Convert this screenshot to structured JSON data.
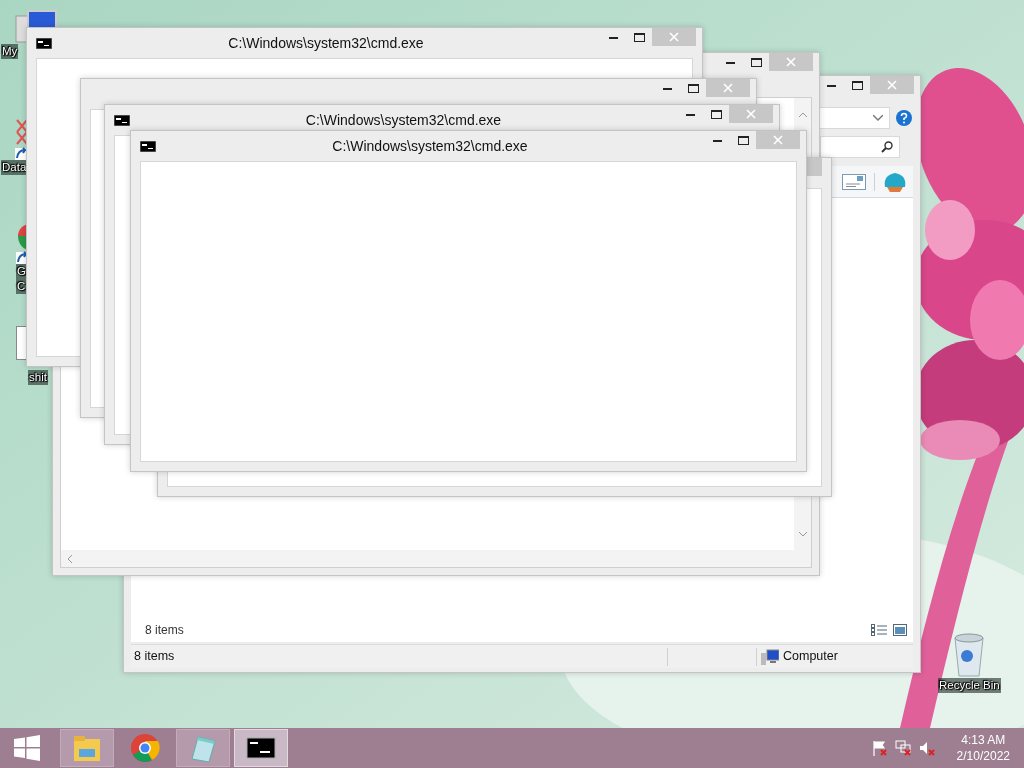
{
  "desktop_icons": [
    {
      "kind": "computer",
      "lines": [
        "My"
      ]
    },
    {
      "kind": "broken-shortcut",
      "lines": [
        "Data"
      ]
    },
    {
      "kind": "chrome-shortcut",
      "lines": [
        "G",
        "C"
      ]
    },
    {
      "kind": "document",
      "lines": [
        "shit"
      ]
    },
    {
      "kind": "recycle",
      "lines": [
        "Recycle Bin"
      ]
    }
  ],
  "windows": [
    {
      "kind": "explorer",
      "item_count": "8 items",
      "status_bar": {
        "left": "8 items",
        "right": "Computer"
      }
    },
    {
      "kind": "scrolled"
    },
    {
      "kind": "console",
      "title": "C:\\Windows\\system32\\cmd.exe"
    },
    {
      "kind": "blank"
    },
    {
      "kind": "console",
      "title": "C:\\Windows\\system32\\cmd.exe"
    },
    {
      "kind": "blank"
    },
    {
      "kind": "console",
      "title": "C:\\Windows\\system32\\cmd.exe"
    }
  ],
  "taskbar": {
    "apps": [
      {
        "kind": "explorer",
        "running": true,
        "selected": false
      },
      {
        "kind": "chrome",
        "running": false,
        "selected": false
      },
      {
        "kind": "notepad",
        "running": true,
        "selected": false
      },
      {
        "kind": "console",
        "running": true,
        "selected": true
      }
    ],
    "tray": [
      {
        "kind": "flag"
      },
      {
        "kind": "network"
      },
      {
        "kind": "volume"
      }
    ],
    "clock": {
      "time": "4:13 AM",
      "date": "2/10/2022"
    }
  }
}
